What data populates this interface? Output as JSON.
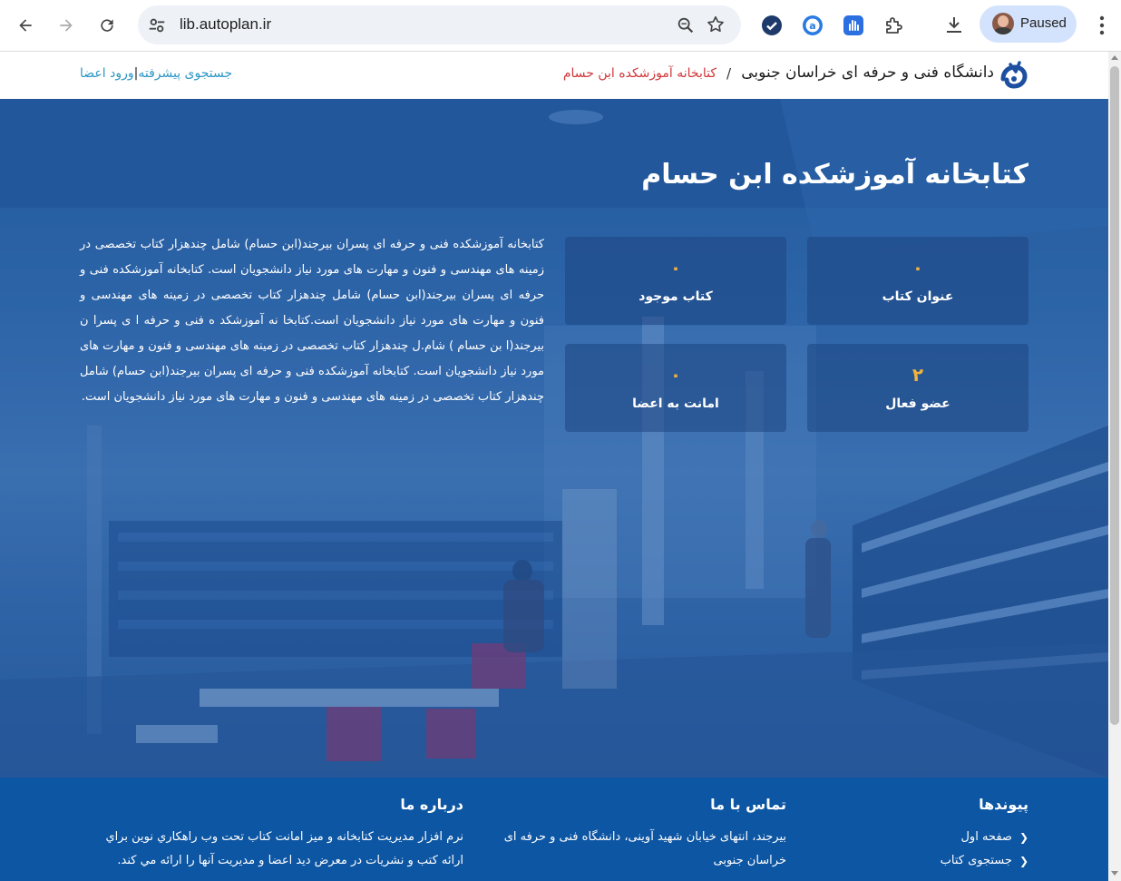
{
  "browser": {
    "url": "lib.autoplan.ir",
    "profile_label": "Paused",
    "icons": [
      "back-arrow-icon",
      "forward-arrow-icon",
      "reload-icon",
      "site-settings-icon",
      "zoom-icon",
      "bookmark-star-icon",
      "extension-check-icon",
      "extension-a-icon",
      "extension-hand-icon",
      "extensions-puzzle-icon",
      "download-icon",
      "menu-dots-icon"
    ]
  },
  "header": {
    "university_name": "دانشگاه فنی و حرفه ای خراسان جنوبی",
    "breadcrumb_separator": "/",
    "breadcrumb_current": "کتابخانه آموزشکده ابن حسام",
    "advanced_search": "جستجوی پیشرفته",
    "link_separator": "|",
    "member_login": "ورود اعضا"
  },
  "hero": {
    "title": "کتابخانه آموزشکده ابن حسام",
    "stats": [
      {
        "value": "۰",
        "label": "عنوان کتاب"
      },
      {
        "value": "۰",
        "label": "کتاب موجود"
      },
      {
        "value": "۲",
        "label": "عضو فعال"
      },
      {
        "value": "۰",
        "label": "امانت به اعضا"
      }
    ],
    "description": "کتابخانه آموزشکده فنی و حرفه ای پسران بیرجند(ابن حسام) شامل چندهزار کتاب تخصصی در زمینه های مهندسی و فنون و مهارت های مورد نیاز دانشجویان است. کتابخانه آموزشکده فنی و حرفه ای پسران بیرجند(ابن حسام) شامل چندهزار کتاب تخصصی در زمینه های مهندسی و فنون و مهارت های مورد نیاز دانشجویان است.کتابخا نه آموزشکد ه فنی و حرفه ا ی پسرا ن بیرجند(ا بن حسام ) شام.ل چندهزار کتاب تخصصی در زمینه های مهندسی و فنون و مهارت های مورد نیاز دانشجویان است. کتابخانه آموزشکده فنی و حرفه ای پسران بیرجند(ابن حسام) شامل چندهزار کتاب تخصصی در زمینه های مهندسی و فنون و مهارت های مورد نیاز دانشجویان است."
  },
  "footer": {
    "links_title": "پیوندها",
    "links": [
      "صفحه اول",
      "جستجوی کتاب"
    ],
    "contact_title": "تماس با ما",
    "contact_text": "بیرجند، انتهای خیابان شهید آوینی، دانشگاه فنی و حرفه ای خراسان جنوبی",
    "about_title": "درباره ما",
    "about_text": "نرم افزار مدیریت کتابخانه و میز امانت کتاب تحت وب راهکاري نوين براي ارائه کتب و نشريات در معرض ديد اعضا و مديريت آنها را ارائه مي کند."
  },
  "colors": {
    "hero_blue": "#2c66a3",
    "footer_blue": "#0d56a3",
    "stat_accent": "#f2b23c",
    "breadcrumb_red": "#d0373a",
    "link_blue": "#2d96c4"
  }
}
